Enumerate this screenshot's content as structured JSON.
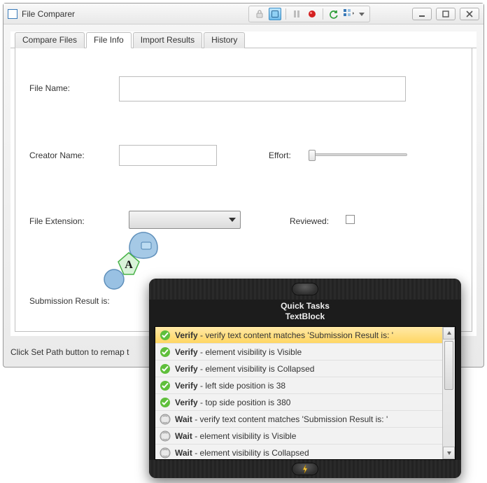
{
  "window": {
    "title": "File Comparer",
    "status": "Click Set Path button to remap t"
  },
  "tabs": [
    {
      "label": "Compare Files"
    },
    {
      "label": "File Info"
    },
    {
      "label": "Import Results"
    },
    {
      "label": "History"
    }
  ],
  "active_tab_index": 1,
  "fileinfo": {
    "file_name_label": "File Name:",
    "file_name_value": "",
    "creator_label": "Creator Name:",
    "creator_value": "",
    "effort_label": "Effort:",
    "extension_label": "File Extension:",
    "extension_value": "",
    "reviewed_label": "Reviewed:",
    "reviewed_checked": false,
    "submission_label": "Submission Result is:"
  },
  "quicktasks": {
    "title_line1": "Quick Tasks",
    "title_line2": "TextBlock",
    "items": [
      {
        "kind": "verify",
        "prefix": "Verify",
        "rest": " - verify text content matches 'Submission Result is: '",
        "selected": true
      },
      {
        "kind": "verify",
        "prefix": "Verify",
        "rest": " - element visibility is Visible",
        "selected": false
      },
      {
        "kind": "verify",
        "prefix": "Verify",
        "rest": " - element visibility is Collapsed",
        "selected": false
      },
      {
        "kind": "verify",
        "prefix": "Verify",
        "rest": " - left side position is 38",
        "selected": false
      },
      {
        "kind": "verify",
        "prefix": "Verify",
        "rest": " - top side position is 380",
        "selected": false
      },
      {
        "kind": "wait",
        "prefix": "Wait",
        "rest": " - verify text content matches 'Submission Result is: '",
        "selected": false
      },
      {
        "kind": "wait",
        "prefix": "Wait",
        "rest": " - element visibility is Visible",
        "selected": false
      },
      {
        "kind": "wait",
        "prefix": "Wait",
        "rest": " - element visibility is Collapsed",
        "selected": false
      }
    ]
  }
}
